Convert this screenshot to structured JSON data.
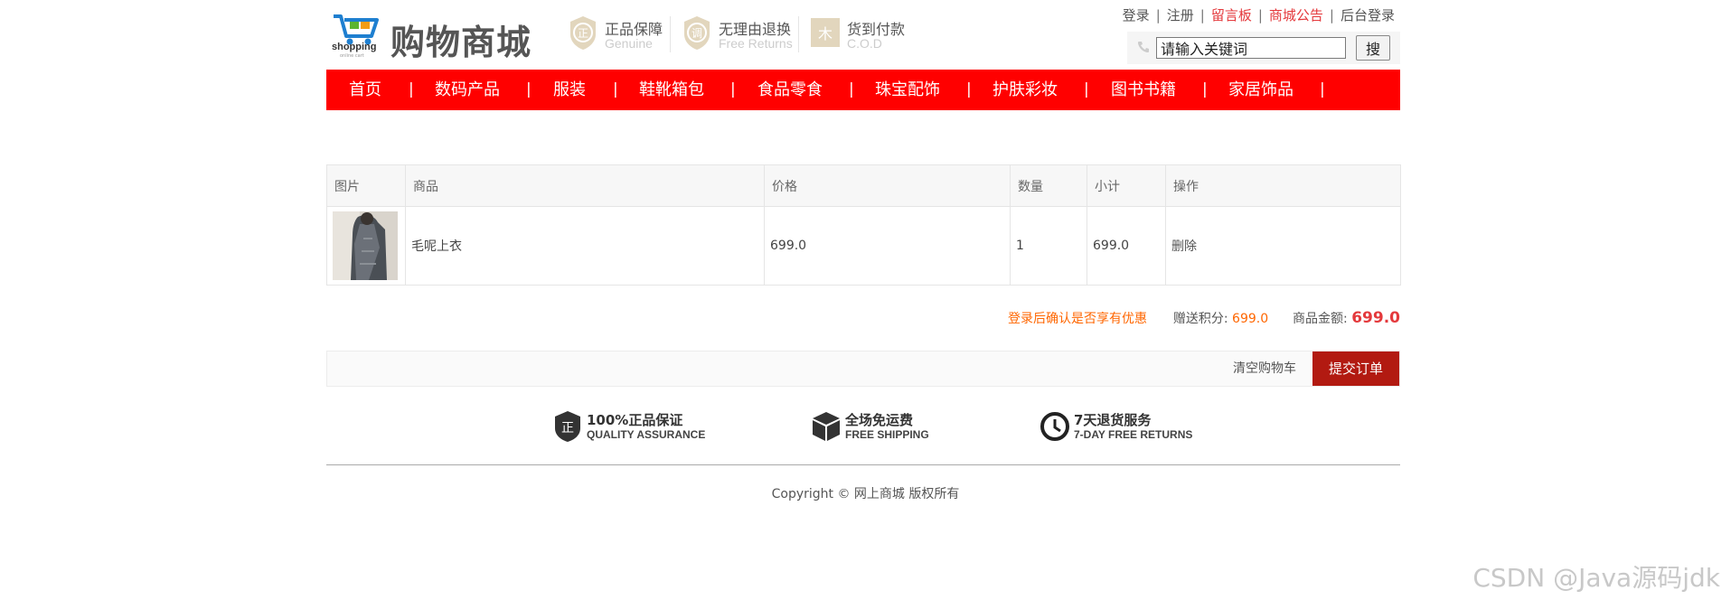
{
  "header": {
    "logo_text": "shopping",
    "logo_subtext": "online cart",
    "site_title": "购物商城",
    "badges": [
      {
        "title": "正品保障",
        "subtitle": "Genuine",
        "icon": "genuine-seal-icon"
      },
      {
        "title": "无理由退换",
        "subtitle": "Free Returns",
        "icon": "return-seal-icon"
      },
      {
        "title": "货到付款",
        "subtitle": "C.O.D",
        "icon": "cod-seal-icon"
      }
    ],
    "top_links": {
      "login": "登录",
      "register": "注册",
      "guestbook": "留言板",
      "announcement": "商城公告",
      "admin_login": "后台登录",
      "separator": "|"
    },
    "search": {
      "value": "请输入关键词",
      "button": "搜"
    }
  },
  "nav": {
    "items": [
      "首页",
      "数码产品",
      "服装",
      "鞋靴箱包",
      "食品零食",
      "珠宝配饰",
      "护肤彩妆",
      "图书书籍",
      "家居饰品"
    ],
    "separator": "|"
  },
  "cart": {
    "columns": [
      "图片",
      "商品",
      "价格",
      "数量",
      "小计",
      "操作"
    ],
    "rows": [
      {
        "image": "coat-thumbnail",
        "name": "毛呢上衣",
        "price": "699.0",
        "quantity": "1",
        "subtotal": "699.0",
        "action": "删除"
      }
    ]
  },
  "summary": {
    "login_prompt": "登录后确认是否享有优惠",
    "points_label": "赠送积分:",
    "points_value": "699.0",
    "amount_label": "商品金额:",
    "amount_value": "699.0"
  },
  "actions": {
    "clear": "清空购物车",
    "submit": "提交订单"
  },
  "guarantees": [
    {
      "title": "100%正品保证",
      "subtitle": "QUALITY ASSURANCE",
      "icon": "quality-shield-icon"
    },
    {
      "title": "全场免运费",
      "subtitle": "FREE SHIPPING",
      "icon": "box-icon"
    },
    {
      "title": "7天退货服务",
      "subtitle": "7-DAY FREE RETURNS",
      "icon": "clock-icon"
    }
  ],
  "footer": {
    "copyright": "Copyright © 网上商城 版权所有"
  },
  "watermark": "CSDN @Java源码jdk",
  "colors": {
    "nav_red": "#ff0000",
    "submit_red": "#b21a11",
    "accent_orange": "#ff6600",
    "link_red": "#e4393c"
  }
}
